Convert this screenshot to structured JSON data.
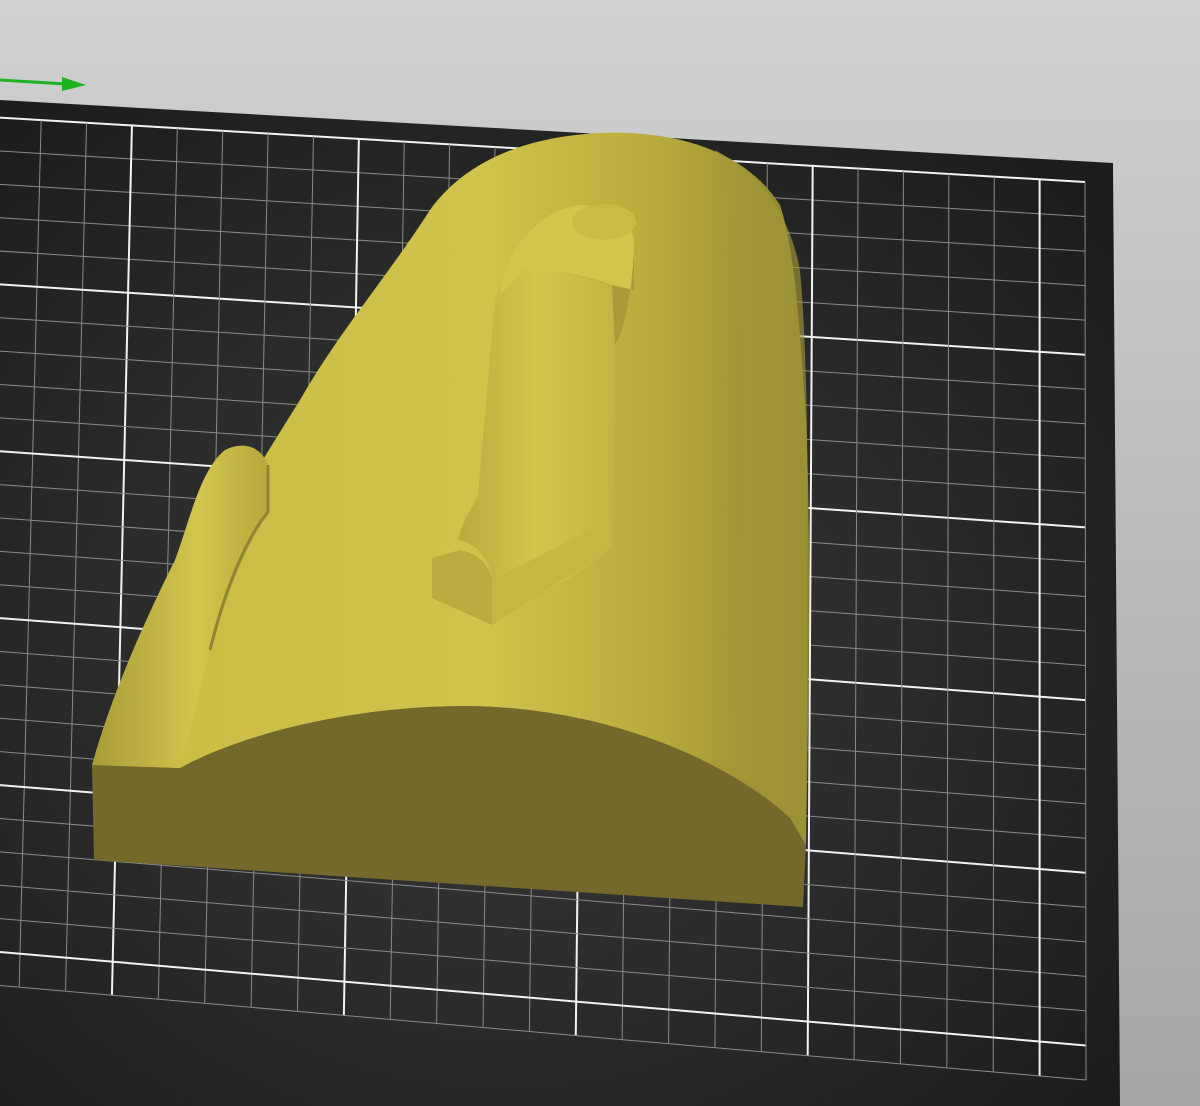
{
  "viewport": {
    "kind": "3d-slicer-viewport",
    "background_top_color": "#cfcfcf",
    "background_bottom_color": "#a9a9a9",
    "bed_color": "#232323",
    "grid_minor_color": "#8a8a8a",
    "grid_major_color": "#f2f2f2",
    "model_color": "#cbbd45",
    "model_side_color": "#74692a",
    "axis_icon": "y-axis-arrow-icon",
    "axis_color": "#1db41d"
  }
}
